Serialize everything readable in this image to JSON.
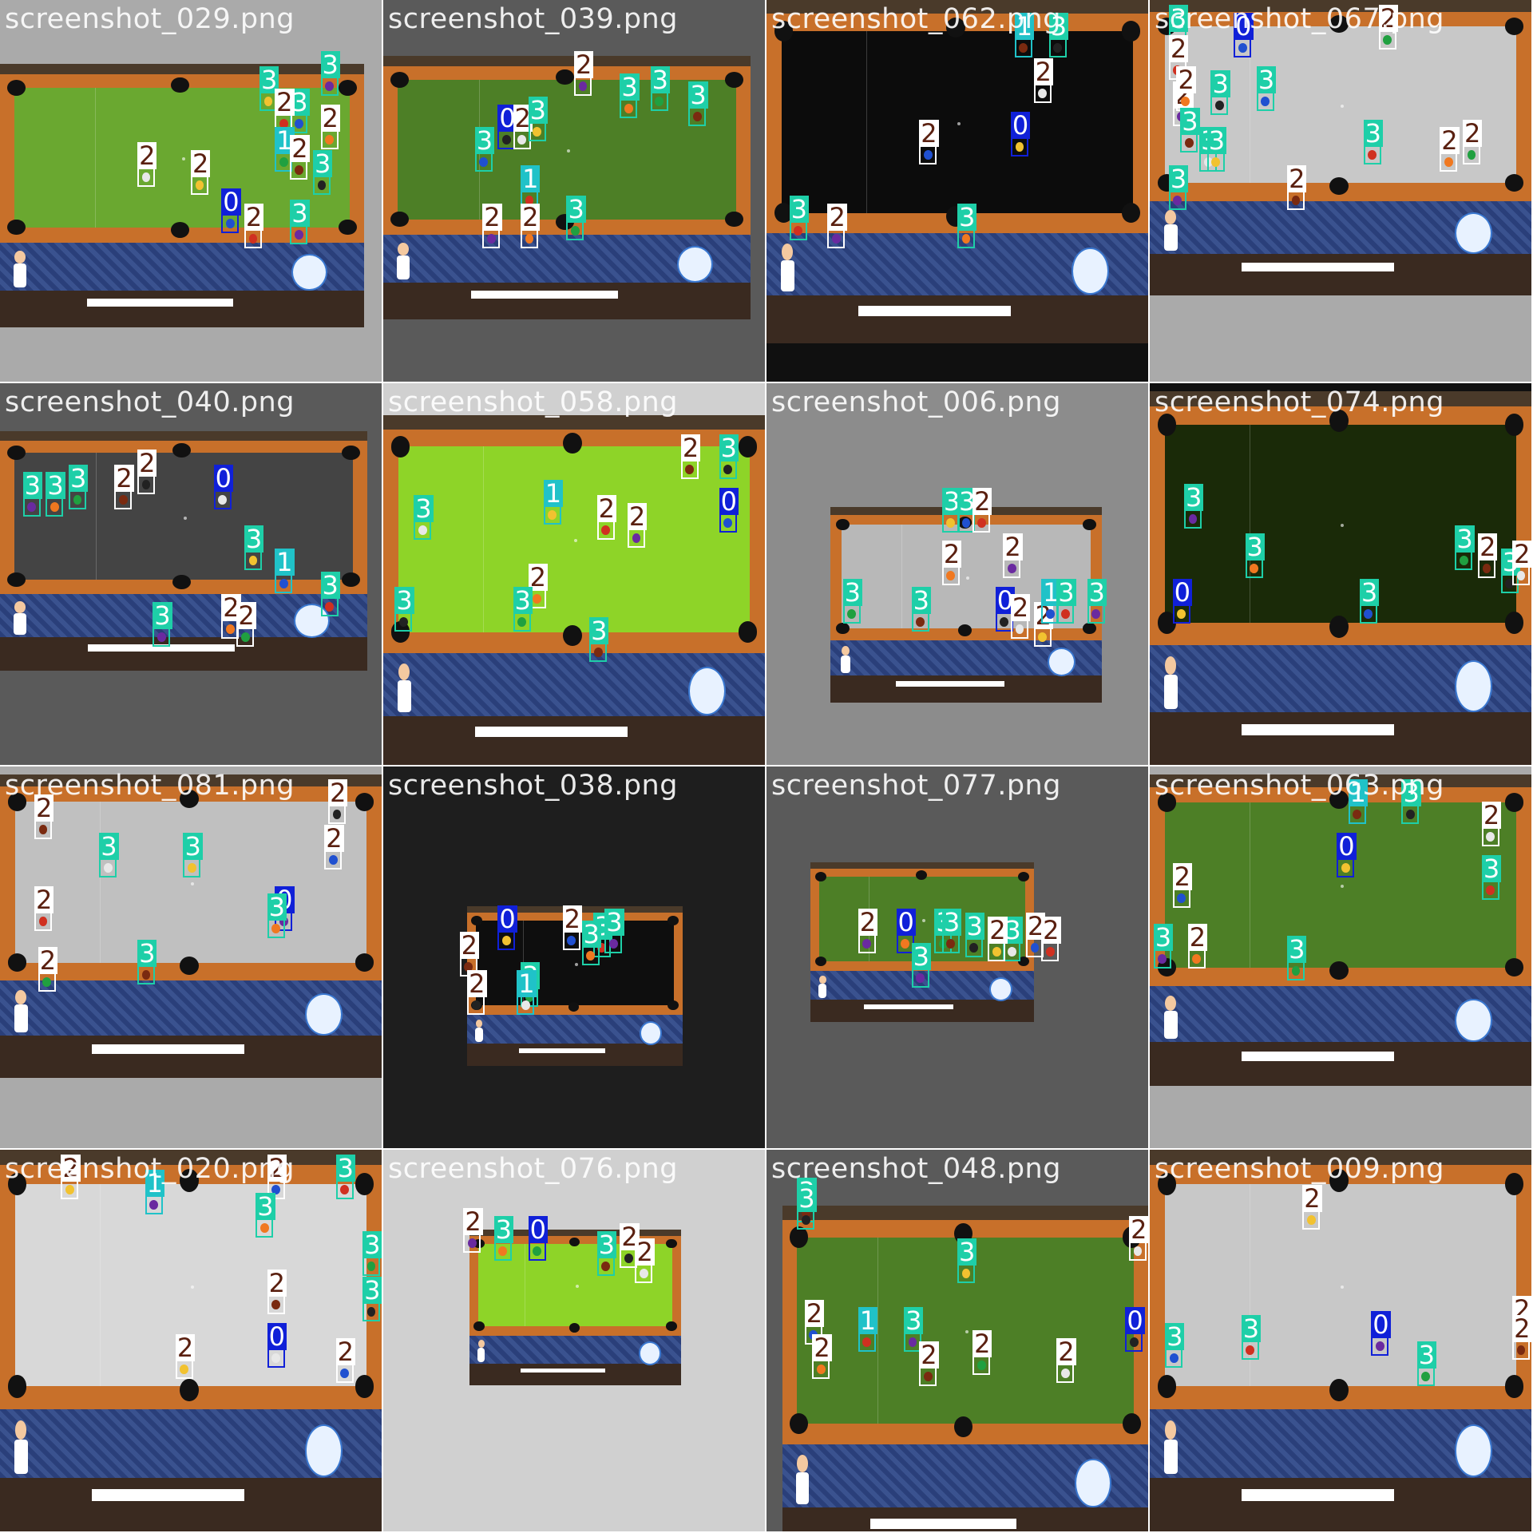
{
  "mosaic": {
    "tiles": [
      {
        "filename": "screenshot_029.png",
        "bg": "#aaaaaa",
        "felt": "#6aa830",
        "labels": [
          "3",
          "3",
          "2",
          "3",
          "2",
          "1",
          "2",
          "3",
          "2",
          "2",
          "0",
          "2",
          "3"
        ]
      },
      {
        "filename": "screenshot_039.png",
        "bg": "#5a5a5a",
        "felt": "#4d7f26",
        "labels": [
          "2",
          "3",
          "3",
          "3",
          "0",
          "2",
          "3",
          "3",
          "1",
          "2",
          "2",
          "3"
        ]
      },
      {
        "filename": "screenshot_062.png",
        "bg": "#101010",
        "felt": "#0c0c0c",
        "labels": [
          "1",
          "3",
          "2",
          "0",
          "2",
          "3",
          "2",
          "3"
        ]
      },
      {
        "filename": "screenshot_067.png",
        "bg": "#aaaaaa",
        "felt": "#c8c8c8",
        "labels": [
          "3",
          "0",
          "2",
          "2",
          "2",
          "2",
          "3",
          "3",
          "3",
          "3",
          "3",
          "3",
          "3",
          "2",
          "2",
          "2"
        ]
      },
      {
        "filename": "screenshot_040.png",
        "bg": "#5a5a5a",
        "felt": "#444444",
        "labels": [
          "3",
          "3",
          "3",
          "2",
          "2",
          "0",
          "3",
          "1",
          "3",
          "3",
          "2",
          "2"
        ]
      },
      {
        "filename": "screenshot_058.png",
        "bg": "#d0d0d0",
        "felt": "#8ed428",
        "labels": [
          "2",
          "3",
          "3",
          "1",
          "0",
          "2",
          "2",
          "2",
          "3",
          "3",
          "3"
        ]
      },
      {
        "filename": "screenshot_006.png",
        "bg": "#8c8c8c",
        "felt": "#b8b8b8",
        "labels": [
          "3",
          "3",
          "2",
          "2",
          "2",
          "3",
          "3",
          "0",
          "2",
          "2",
          "1",
          "3",
          "3"
        ]
      },
      {
        "filename": "screenshot_074.png",
        "bg": "#101010",
        "felt": "#1a2a08",
        "labels": [
          "3",
          "3",
          "3",
          "2",
          "3",
          "2",
          "0",
          "3"
        ]
      },
      {
        "filename": "screenshot_081.png",
        "bg": "#aaaaaa",
        "felt": "#c0c0c0",
        "labels": [
          "2",
          "2",
          "3",
          "3",
          "2",
          "2",
          "0",
          "3",
          "2",
          "3"
        ]
      },
      {
        "filename": "screenshot_038.png",
        "bg": "#1e1e1e",
        "felt": "#0e0e0e",
        "labels": [
          "0",
          "2",
          "3",
          "3",
          "3",
          "3",
          "2",
          "2",
          "1"
        ]
      },
      {
        "filename": "screenshot_077.png",
        "bg": "#5a5a5a",
        "felt": "#4d7f26",
        "labels": [
          "2",
          "0",
          "3",
          "3",
          "3",
          "3",
          "2",
          "2",
          "2",
          "3"
        ]
      },
      {
        "filename": "screenshot_063.png",
        "bg": "#aaaaaa",
        "felt": "#4d7f26",
        "labels": [
          "1",
          "3",
          "2",
          "0",
          "2",
          "3",
          "3",
          "2",
          "3"
        ]
      },
      {
        "filename": "screenshot_020.png",
        "bg": "#aaaaaa",
        "felt": "#d8d8d8",
        "labels": [
          "2",
          "2",
          "3",
          "1",
          "3",
          "3",
          "2",
          "3",
          "0",
          "2",
          "2"
        ]
      },
      {
        "filename": "screenshot_076.png",
        "bg": "#d0d0d0",
        "felt": "#8ed428",
        "labels": [
          "2",
          "3",
          "0",
          "3",
          "2",
          "2"
        ]
      },
      {
        "filename": "screenshot_048.png",
        "bg": "#5a5a5a",
        "felt": "#4d7f26",
        "labels": [
          "3",
          "3",
          "2",
          "3",
          "2",
          "1",
          "3",
          "2",
          "2",
          "2",
          "0",
          "2"
        ]
      },
      {
        "filename": "screenshot_009.png",
        "bg": "#aaaaaa",
        "felt": "#c8c8c8",
        "labels": [
          "2",
          "3",
          "3",
          "0",
          "2",
          "3",
          "2"
        ]
      }
    ]
  }
}
